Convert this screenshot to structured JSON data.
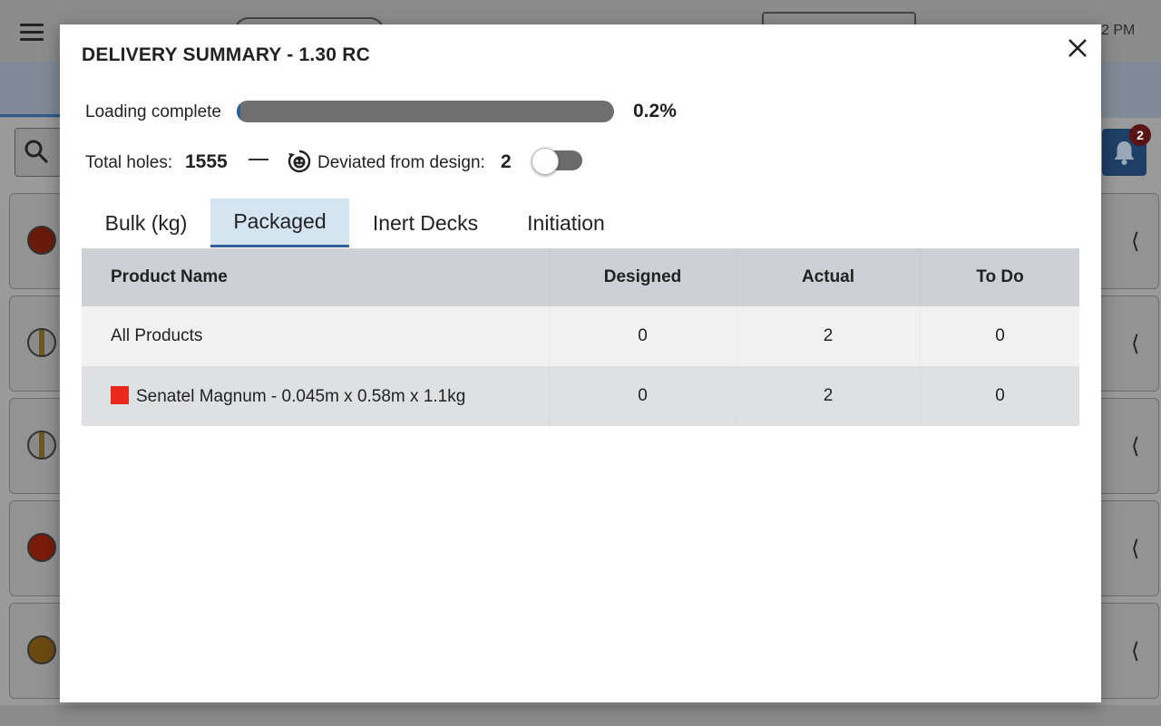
{
  "background": {
    "time": "2 PM",
    "notification_count": "2"
  },
  "modal": {
    "title": "DELIVERY SUMMARY - 1.30 RC",
    "progress": {
      "label": "Loading complete",
      "value_text": "0.2%",
      "fraction": 0.002
    },
    "holes": {
      "label": "Total holes:",
      "value": "1555"
    },
    "deviation": {
      "label": "Deviated from design:",
      "value": "2",
      "toggle_on": false
    },
    "tabs": [
      {
        "label": "Bulk (kg)",
        "active": false
      },
      {
        "label": "Packaged",
        "active": true
      },
      {
        "label": "Inert Decks",
        "active": false
      },
      {
        "label": "Initiation",
        "active": false
      }
    ],
    "table": {
      "headers": [
        "Product Name",
        "Designed",
        "Actual",
        "To Do"
      ],
      "rows": [
        {
          "name": "All Products",
          "designed": "0",
          "actual": "2",
          "todo": "0",
          "color": null
        },
        {
          "name": "Senatel Magnum - 0.045m x 0.58m x 1.1kg",
          "designed": "0",
          "actual": "2",
          "todo": "0",
          "color": "#e8291b"
        }
      ]
    }
  },
  "colors": {
    "accent": "#2f5f9a",
    "active_tab_bg": "#d5e4f1",
    "header_bg": "#cdd0d4",
    "progress_track": "#6f6f6f"
  }
}
